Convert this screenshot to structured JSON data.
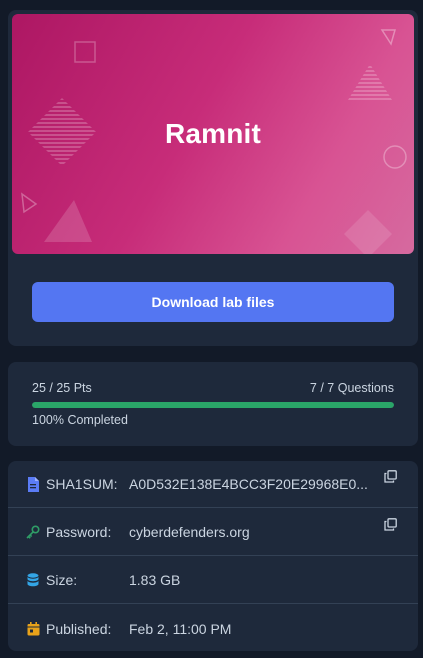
{
  "lab": {
    "title": "Ramnit",
    "download_label": "Download lab files"
  },
  "progress": {
    "points": "25 / 25 Pts",
    "questions": "7 / 7 Questions",
    "completed": "100% Completed",
    "fraction": 1.0
  },
  "info": [
    {
      "label": "SHA1SUM:",
      "value": "A0D532E138E4BCC3F20E29968E0...",
      "icon": "file-icon",
      "icon_color": "#5b7cf6",
      "copyable": true
    },
    {
      "label": "Password:",
      "value": "cyberdefenders.org",
      "icon": "key-icon",
      "icon_color": "#2f9e67",
      "copyable": true
    },
    {
      "label": "Size:",
      "value": "1.83 GB",
      "icon": "database-icon",
      "icon_color": "#33a5e6",
      "copyable": false
    },
    {
      "label": "Published:",
      "value": "Feb 2, 11:00 PM",
      "icon": "calendar-icon",
      "icon_color": "#e8a21a",
      "copyable": false
    }
  ],
  "colors": {
    "background": "#121a28",
    "card": "#1e293b",
    "accent": "#5476f2",
    "progress": "#2aa568",
    "banner_start": "#ad1763",
    "banner_end": "#d66a9f"
  }
}
